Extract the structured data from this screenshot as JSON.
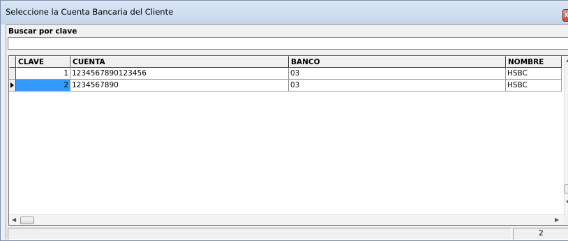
{
  "window": {
    "title": "Seleccione la Cuenta Bancaria del Cliente",
    "close_glyph": "x"
  },
  "search": {
    "label": "Buscar por clave",
    "value": "",
    "placeholder": ""
  },
  "grid": {
    "columns": [
      "CLAVE",
      "CUENTA",
      "BANCO",
      "NOMBRE"
    ],
    "rows": [
      {
        "clave": "1",
        "cuenta": "1234567890123456",
        "banco": "03",
        "nombre": "HSBC"
      },
      {
        "clave": "2",
        "cuenta": "1234567890",
        "banco": "03",
        "nombre": "HSBC"
      }
    ],
    "selected_row": 2
  },
  "status": {
    "record_count": "2"
  },
  "colors": {
    "selection": "#3399ff",
    "title_bar": "#cfdef0"
  }
}
